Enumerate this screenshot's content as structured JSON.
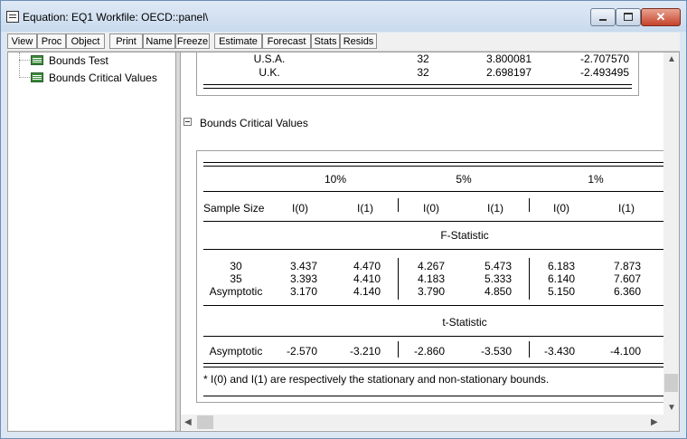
{
  "window": {
    "title": "Equation: EQ1   Workfile: OECD::panel\\",
    "controls": {
      "minimize": "minimize",
      "maximize": "maximize",
      "close": "✕"
    }
  },
  "toolbar": [
    "View",
    "Proc",
    "Object",
    "Print",
    "Name",
    "Freeze",
    "Estimate",
    "Forecast",
    "Stats",
    "Resids"
  ],
  "tree": {
    "items": [
      {
        "label": "Bounds Test"
      },
      {
        "label": "Bounds Critical Values"
      }
    ]
  },
  "bounds_test_tail": {
    "rows": [
      {
        "country": "U.S.A.",
        "n": "32",
        "f": "3.800081",
        "t": "-2.707570"
      },
      {
        "country": "U.K.",
        "n": "32",
        "f": "2.698197",
        "t": "-2.493495"
      }
    ]
  },
  "critical_values": {
    "section_title": "Bounds Critical Values",
    "levels": [
      "10%",
      "5%",
      "1%"
    ],
    "col_headers": [
      "Sample Size",
      "I(0)",
      "I(1)",
      "I(0)",
      "I(1)",
      "I(0)",
      "I(1)"
    ],
    "f_title": "F-Statistic",
    "f_rows": [
      {
        "size": "30",
        "v": [
          "3.437",
          "4.470",
          "4.267",
          "5.473",
          "6.183",
          "7.873"
        ]
      },
      {
        "size": "35",
        "v": [
          "3.393",
          "4.410",
          "4.183",
          "5.333",
          "6.140",
          "7.607"
        ]
      },
      {
        "size": "Asymptotic",
        "v": [
          "3.170",
          "4.140",
          "3.790",
          "4.850",
          "5.150",
          "6.360"
        ]
      }
    ],
    "t_title": "t-Statistic",
    "t_rows": [
      {
        "size": "Asymptotic",
        "v": [
          "-2.570",
          "-3.210",
          "-2.860",
          "-3.530",
          "-3.430",
          "-4.100"
        ]
      }
    ],
    "footnote": "* I(0) and I(1) are respectively the stationary and non-stationary bounds."
  }
}
